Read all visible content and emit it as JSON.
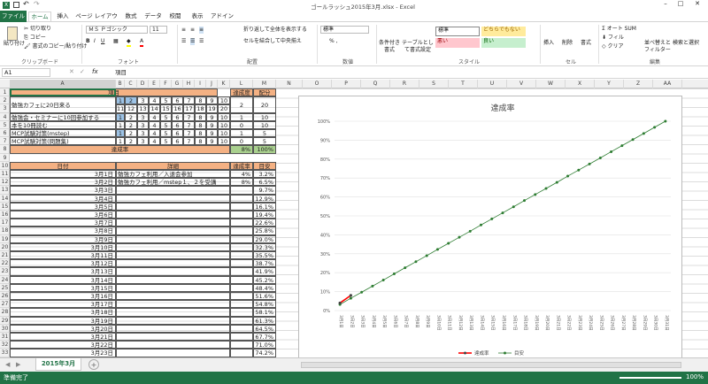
{
  "title": "ゴールラッシュ2015年3月.xlsx - Excel",
  "tabs": [
    "ファイル",
    "ホーム",
    "挿入",
    "ページ レイアウト",
    "数式",
    "データ",
    "校閲",
    "表示",
    "アドイン"
  ],
  "ribbon": {
    "paste": "貼り付け",
    "cut": "切り取り",
    "copy": "コピー",
    "format_painter": "書式のコピー/貼り付け",
    "font_name": "ＭＳ Ｐゴシック",
    "font_size": "11",
    "wrap": "折り返して全体を表示する",
    "merge": "セルを結合して中央揃え",
    "number_format": "標準",
    "cond_format": "条件付き書式",
    "table_format": "テーブルとして書式設定",
    "styles": [
      "標準",
      "どちらでもない",
      "悪い",
      "良い"
    ],
    "insert": "挿入",
    "delete": "削除",
    "format": "書式",
    "autosum": "オート SUM",
    "fill": "フィル",
    "clear": "クリア",
    "sort": "並べ替えとフィルター",
    "find": "検索と選択",
    "groups": [
      "クリップボード",
      "フォント",
      "配置",
      "数値",
      "スタイル",
      "セル",
      "編集"
    ]
  },
  "formula": {
    "namebox": "A1",
    "fx": "fx",
    "content": "項目"
  },
  "columns": [
    "A",
    "B",
    "C",
    "D",
    "E",
    "F",
    "G",
    "H",
    "I",
    "J",
    "K",
    "L",
    "M",
    "N",
    "O",
    "P",
    "Q",
    "R",
    "S",
    "T",
    "U",
    "V",
    "W",
    "X",
    "Y",
    "Z",
    "AA"
  ],
  "rows": [
    "1",
    "2",
    "3",
    "4",
    "5",
    "6",
    "7",
    "8",
    "9",
    "10",
    "11",
    "12",
    "13",
    "14",
    "15",
    "16",
    "17",
    "18",
    "19",
    "20",
    "21",
    "22",
    "23",
    "24",
    "25",
    "26",
    "27",
    "28",
    "29",
    "30",
    "31",
    "32",
    "33"
  ],
  "table1": {
    "h_item": "項目",
    "h_rate": "達成度",
    "h_pts": "配分",
    "items": [
      {
        "label": "勉強カフェに20日来る",
        "a": [
          "1",
          "2",
          "3",
          "4",
          "5",
          "6",
          "7",
          "8",
          "9",
          "10"
        ],
        "b": [
          "11",
          "12",
          "13",
          "14",
          "15",
          "16",
          "17",
          "18",
          "19",
          "20"
        ],
        "rate": "2",
        "pts": "20"
      },
      {
        "label": "勉強会・セミナーに10回参加する",
        "a": [
          "1",
          "2",
          "3",
          "4",
          "5",
          "6",
          "7",
          "8",
          "9",
          "10"
        ],
        "rate": "1",
        "pts": "10"
      },
      {
        "label": "本を10冊読む",
        "a": [
          "1",
          "2",
          "3",
          "4",
          "5",
          "6",
          "7",
          "8",
          "9",
          "10"
        ],
        "rate": "0",
        "pts": "10"
      },
      {
        "label": "MCP試験対策(mstep)",
        "a": [
          "1",
          "2",
          "3",
          "4",
          "5",
          "6",
          "7",
          "8",
          "9",
          "10"
        ],
        "rate": "1",
        "pts": "5"
      },
      {
        "label": "MCP試験対策(問題集)",
        "a": [
          "1",
          "2",
          "3",
          "4",
          "5",
          "6",
          "7",
          "8",
          "9",
          "10"
        ],
        "rate": "0",
        "pts": "5"
      }
    ],
    "total_label": "達成率",
    "total_pct": "8%",
    "total_max": "100%"
  },
  "table2": {
    "h_date": "日付",
    "h_detail": "詳細",
    "h_rate": "達成率",
    "h_target": "目安",
    "rows": [
      {
        "d": "3月1日",
        "t": "勉強カフェ利用／入退会参加",
        "r": "4%",
        "g": "3.2%"
      },
      {
        "d": "3月2日",
        "t": "勉強カフェ利用／mstep１、２を受講",
        "r": "8%",
        "g": "6.5%"
      },
      {
        "d": "3月3日",
        "t": "",
        "r": "",
        "g": "9.7%"
      },
      {
        "d": "3月4日",
        "t": "",
        "r": "",
        "g": "12.9%"
      },
      {
        "d": "3月5日",
        "t": "",
        "r": "",
        "g": "16.1%"
      },
      {
        "d": "3月6日",
        "t": "",
        "r": "",
        "g": "19.4%"
      },
      {
        "d": "3月7日",
        "t": "",
        "r": "",
        "g": "22.6%"
      },
      {
        "d": "3月8日",
        "t": "",
        "r": "",
        "g": "25.8%"
      },
      {
        "d": "3月9日",
        "t": "",
        "r": "",
        "g": "29.0%"
      },
      {
        "d": "3月10日",
        "t": "",
        "r": "",
        "g": "32.3%"
      },
      {
        "d": "3月11日",
        "t": "",
        "r": "",
        "g": "35.5%"
      },
      {
        "d": "3月12日",
        "t": "",
        "r": "",
        "g": "38.7%"
      },
      {
        "d": "3月13日",
        "t": "",
        "r": "",
        "g": "41.9%"
      },
      {
        "d": "3月14日",
        "t": "",
        "r": "",
        "g": "45.2%"
      },
      {
        "d": "3月15日",
        "t": "",
        "r": "",
        "g": "48.4%"
      },
      {
        "d": "3月16日",
        "t": "",
        "r": "",
        "g": "51.6%"
      },
      {
        "d": "3月17日",
        "t": "",
        "r": "",
        "g": "54.8%"
      },
      {
        "d": "3月18日",
        "t": "",
        "r": "",
        "g": "58.1%"
      },
      {
        "d": "3月19日",
        "t": "",
        "r": "",
        "g": "61.3%"
      },
      {
        "d": "3月20日",
        "t": "",
        "r": "",
        "g": "64.5%"
      },
      {
        "d": "3月21日",
        "t": "",
        "r": "",
        "g": "67.7%"
      },
      {
        "d": "3月22日",
        "t": "",
        "r": "",
        "g": "71.0%"
      },
      {
        "d": "3月23日",
        "t": "",
        "r": "",
        "g": "74.2%"
      }
    ]
  },
  "chart_data": {
    "type": "line",
    "title": "達成率",
    "ylim": [
      0,
      100
    ],
    "yticks": [
      "0%",
      "10%",
      "20%",
      "30%",
      "40%",
      "50%",
      "60%",
      "70%",
      "80%",
      "90%",
      "100%"
    ],
    "x": [
      "3月1日",
      "3月2日",
      "3月3日",
      "3月4日",
      "3月5日",
      "3月6日",
      "3月7日",
      "3月8日",
      "3月9日",
      "3月10日",
      "3月11日",
      "3月12日",
      "3月13日",
      "3月14日",
      "3月15日",
      "3月16日",
      "3月17日",
      "3月18日",
      "3月19日",
      "3月20日",
      "3月21日",
      "3月22日",
      "3月23日",
      "3月24日",
      "3月25日",
      "3月26日",
      "3月27日",
      "3月28日",
      "3月29日",
      "3月30日",
      "3月31日"
    ],
    "series": [
      {
        "name": "達成率",
        "color": "#ff0000",
        "values": [
          4,
          8
        ]
      },
      {
        "name": "目安",
        "color": "#2e7d32",
        "values": [
          3.2,
          6.5,
          9.7,
          12.9,
          16.1,
          19.4,
          22.6,
          25.8,
          29.0,
          32.3,
          35.5,
          38.7,
          41.9,
          45.2,
          48.4,
          51.6,
          54.8,
          58.1,
          61.3,
          64.5,
          67.7,
          71.0,
          74.2,
          77.4,
          80.6,
          83.9,
          87.1,
          90.3,
          93.5,
          96.8,
          100
        ]
      }
    ],
    "legend": "bottom"
  },
  "sheet": {
    "name": "2015年3月",
    "add": "+"
  },
  "status": {
    "ready": "準備完了",
    "zoom": "100%"
  },
  "colors": {
    "header_orange": "#f4b183",
    "highlight_blue": "#9dc3e6",
    "total_green": "#a9d08e",
    "excel_green": "#217346"
  }
}
